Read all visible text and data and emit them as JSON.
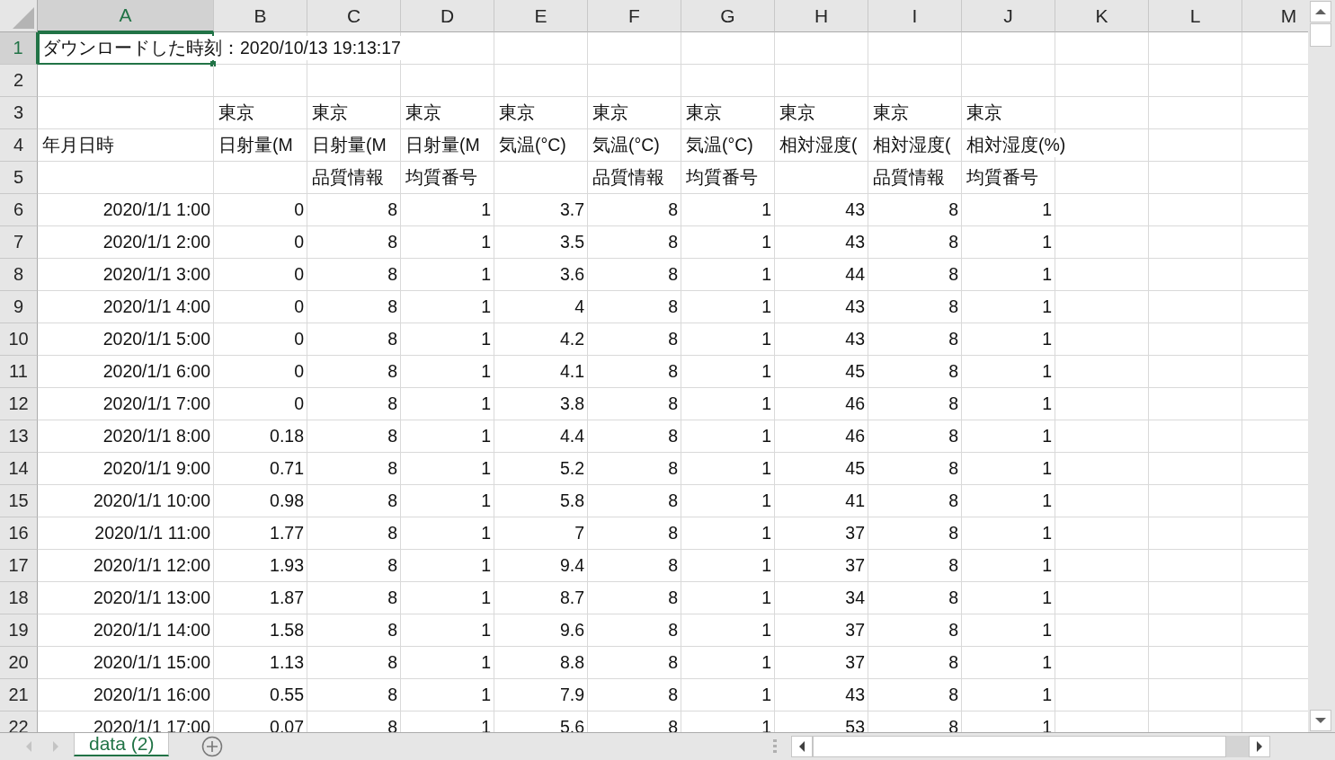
{
  "columns": [
    {
      "label": "A",
      "selected": true
    },
    {
      "label": "B",
      "selected": false
    },
    {
      "label": "C",
      "selected": false
    },
    {
      "label": "D",
      "selected": false
    },
    {
      "label": "E",
      "selected": false
    },
    {
      "label": "F",
      "selected": false
    },
    {
      "label": "G",
      "selected": false
    },
    {
      "label": "H",
      "selected": false
    },
    {
      "label": "I",
      "selected": false
    },
    {
      "label": "J",
      "selected": false
    },
    {
      "label": "K",
      "selected": false
    },
    {
      "label": "L",
      "selected": false
    },
    {
      "label": "M",
      "selected": false
    }
  ],
  "rows": [
    {
      "number": "1",
      "selected": true,
      "kind": "text",
      "cells": [
        "ダウンロードした時刻：2020/10/13 19:13:17"
      ]
    },
    {
      "number": "2",
      "selected": false,
      "kind": "text",
      "cells": []
    },
    {
      "number": "3",
      "selected": false,
      "kind": "text",
      "cells": [
        null,
        "東京",
        "東京",
        "東京",
        "東京",
        "東京",
        "東京",
        "東京",
        "東京",
        "東京"
      ]
    },
    {
      "number": "4",
      "selected": false,
      "kind": "text",
      "cells": [
        "年月日時",
        "日射量(M",
        "日射量(M",
        "日射量(M",
        "気温(°C)",
        "気温(°C)",
        "気温(°C)",
        "相対湿度(",
        "相対湿度(",
        "相対湿度(%)"
      ]
    },
    {
      "number": "5",
      "selected": false,
      "kind": "text",
      "cells": [
        null,
        null,
        "品質情報",
        "均質番号",
        null,
        "品質情報",
        "均質番号",
        null,
        "品質情報",
        "均質番号"
      ]
    },
    {
      "number": "6",
      "selected": false,
      "kind": "data",
      "cells": [
        "2020/1/1 1:00",
        "0",
        "8",
        "1",
        "3.7",
        "8",
        "1",
        "43",
        "8",
        "1"
      ]
    },
    {
      "number": "7",
      "selected": false,
      "kind": "data",
      "cells": [
        "2020/1/1 2:00",
        "0",
        "8",
        "1",
        "3.5",
        "8",
        "1",
        "43",
        "8",
        "1"
      ]
    },
    {
      "number": "8",
      "selected": false,
      "kind": "data",
      "cells": [
        "2020/1/1 3:00",
        "0",
        "8",
        "1",
        "3.6",
        "8",
        "1",
        "44",
        "8",
        "1"
      ]
    },
    {
      "number": "9",
      "selected": false,
      "kind": "data",
      "cells": [
        "2020/1/1 4:00",
        "0",
        "8",
        "1",
        "4",
        "8",
        "1",
        "43",
        "8",
        "1"
      ]
    },
    {
      "number": "10",
      "selected": false,
      "kind": "data",
      "cells": [
        "2020/1/1 5:00",
        "0",
        "8",
        "1",
        "4.2",
        "8",
        "1",
        "43",
        "8",
        "1"
      ]
    },
    {
      "number": "11",
      "selected": false,
      "kind": "data",
      "cells": [
        "2020/1/1 6:00",
        "0",
        "8",
        "1",
        "4.1",
        "8",
        "1",
        "45",
        "8",
        "1"
      ]
    },
    {
      "number": "12",
      "selected": false,
      "kind": "data",
      "cells": [
        "2020/1/1 7:00",
        "0",
        "8",
        "1",
        "3.8",
        "8",
        "1",
        "46",
        "8",
        "1"
      ]
    },
    {
      "number": "13",
      "selected": false,
      "kind": "data",
      "cells": [
        "2020/1/1 8:00",
        "0.18",
        "8",
        "1",
        "4.4",
        "8",
        "1",
        "46",
        "8",
        "1"
      ]
    },
    {
      "number": "14",
      "selected": false,
      "kind": "data",
      "cells": [
        "2020/1/1 9:00",
        "0.71",
        "8",
        "1",
        "5.2",
        "8",
        "1",
        "45",
        "8",
        "1"
      ]
    },
    {
      "number": "15",
      "selected": false,
      "kind": "data",
      "cells": [
        "2020/1/1 10:00",
        "0.98",
        "8",
        "1",
        "5.8",
        "8",
        "1",
        "41",
        "8",
        "1"
      ]
    },
    {
      "number": "16",
      "selected": false,
      "kind": "data",
      "cells": [
        "2020/1/1 11:00",
        "1.77",
        "8",
        "1",
        "7",
        "8",
        "1",
        "37",
        "8",
        "1"
      ]
    },
    {
      "number": "17",
      "selected": false,
      "kind": "data",
      "cells": [
        "2020/1/1 12:00",
        "1.93",
        "8",
        "1",
        "9.4",
        "8",
        "1",
        "37",
        "8",
        "1"
      ]
    },
    {
      "number": "18",
      "selected": false,
      "kind": "data",
      "cells": [
        "2020/1/1 13:00",
        "1.87",
        "8",
        "1",
        "8.7",
        "8",
        "1",
        "34",
        "8",
        "1"
      ]
    },
    {
      "number": "19",
      "selected": false,
      "kind": "data",
      "cells": [
        "2020/1/1 14:00",
        "1.58",
        "8",
        "1",
        "9.6",
        "8",
        "1",
        "37",
        "8",
        "1"
      ]
    },
    {
      "number": "20",
      "selected": false,
      "kind": "data",
      "cells": [
        "2020/1/1 15:00",
        "1.13",
        "8",
        "1",
        "8.8",
        "8",
        "1",
        "37",
        "8",
        "1"
      ]
    },
    {
      "number": "21",
      "selected": false,
      "kind": "data",
      "cells": [
        "2020/1/1 16:00",
        "0.55",
        "8",
        "1",
        "7.9",
        "8",
        "1",
        "43",
        "8",
        "1"
      ]
    },
    {
      "number": "22",
      "selected": false,
      "kind": "data",
      "cells": [
        "2020/1/1 17:00",
        "0.07",
        "8",
        "1",
        "5.6",
        "8",
        "1",
        "53",
        "8",
        "1"
      ]
    }
  ],
  "sheet_tabs": [
    {
      "label": "data (2)",
      "selected": true
    }
  ]
}
